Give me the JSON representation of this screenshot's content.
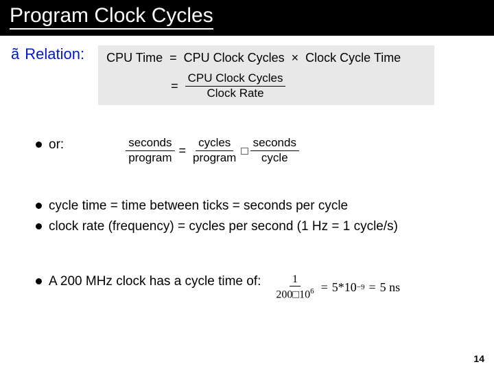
{
  "title": "Program Clock Cycles",
  "topBullet": "ã",
  "topLabel": "Relation:",
  "formula1": {
    "lhs": "CPU Time",
    "rhs_a": "CPU Clock Cycles",
    "op": "×",
    "rhs_b": "Clock Cycle Time",
    "line2_num": "CPU Clock Cycles",
    "line2_den": "Clock Rate"
  },
  "or": {
    "label": "or:",
    "t1_num": "seconds",
    "t1_den": "program",
    "t2_num": "cycles",
    "t2_den": "program",
    "box": "□",
    "t3_num": "seconds",
    "t3_den": "cycle"
  },
  "defs": {
    "cycle_time": "cycle time = time between ticks = seconds per cycle",
    "clock_rate": "clock rate (frequency) = cycles per second  (1 Hz = 1 cycle/s)"
  },
  "example": {
    "text": "A 200 MHz clock has a cycle time of:",
    "frac_num": "1",
    "frac_den_a": "200",
    "frac_den_box": "□",
    "frac_den_b": "10",
    "frac_den_exp": "6",
    "eq": "=",
    "rhs_a": "5",
    "rhs_star": "*",
    "rhs_b": "10",
    "rhs_exp": "−9",
    "rhs_eq": "=",
    "rhs_val": "5 ns"
  },
  "pageNumber": "14"
}
